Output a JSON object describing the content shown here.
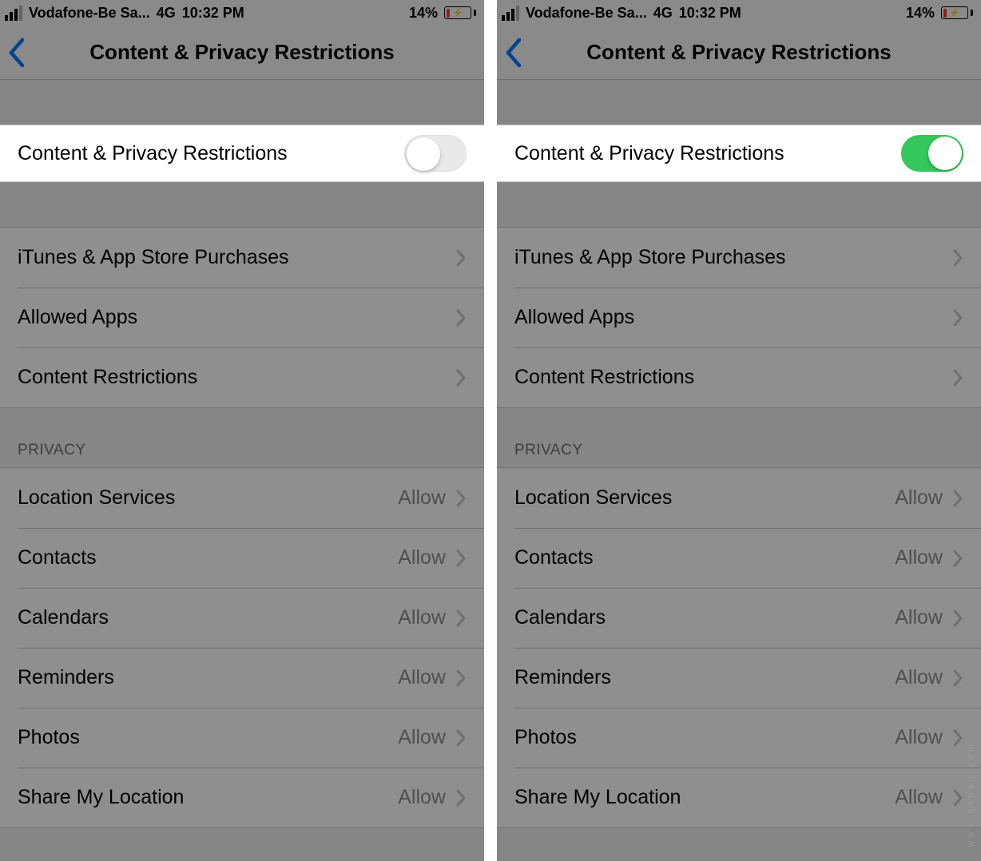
{
  "status": {
    "carrier": "Vodafone-Be Sa...",
    "network": "4G",
    "time": "10:32 PM",
    "battery_percent": "14%"
  },
  "nav": {
    "title": "Content & Privacy Restrictions"
  },
  "toggle": {
    "label": "Content & Privacy Restrictions"
  },
  "group_main": {
    "items": [
      {
        "label": "iTunes & App Store Purchases"
      },
      {
        "label": "Allowed Apps"
      },
      {
        "label": "Content Restrictions"
      }
    ]
  },
  "privacy": {
    "header": "PRIVACY",
    "items": [
      {
        "label": "Location Services",
        "value": "Allow"
      },
      {
        "label": "Contacts",
        "value": "Allow"
      },
      {
        "label": "Calendars",
        "value": "Allow"
      },
      {
        "label": "Reminders",
        "value": "Allow"
      },
      {
        "label": "Photos",
        "value": "Allow"
      },
      {
        "label": "Share My Location",
        "value": "Allow"
      }
    ]
  },
  "watermark": "www.deuaq.com",
  "left_toggle_state": "off",
  "right_toggle_state": "on"
}
